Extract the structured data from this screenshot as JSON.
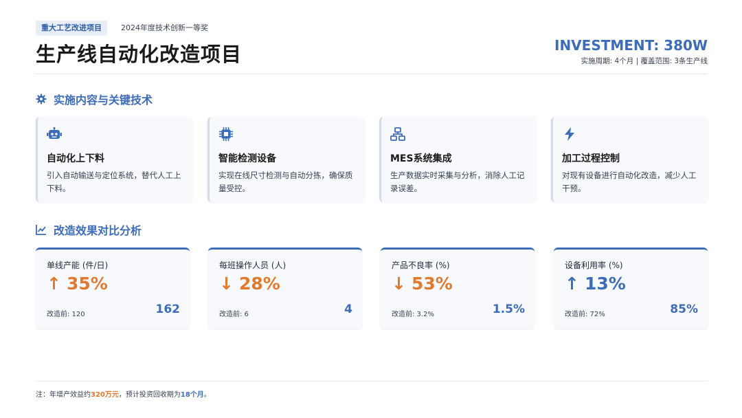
{
  "header": {
    "tag": "重大工艺改进项目",
    "award": "2024年度技术创新一等奖",
    "title": "生产线自动化改造项目",
    "investment": "INVESTMENT: 380W",
    "meta": "实施周期: 4个月 | 覆盖范围: 3条生产线"
  },
  "section_tech": {
    "title": "实施内容与关键技术",
    "icon": "gear-icon"
  },
  "tech": [
    {
      "icon": "robot-icon",
      "title": "自动化上下料",
      "desc": "引入自动输送与定位系统，替代人工上下料。"
    },
    {
      "icon": "chip-icon",
      "title": "智能检测设备",
      "desc": "实现在线尺寸检测与自动分拣，确保质量受控。"
    },
    {
      "icon": "network-icon",
      "title": "MES系统集成",
      "desc": "生产数据实时采集与分析，消除人工记录误差。"
    },
    {
      "icon": "bolt-icon",
      "title": "加工过程控制",
      "desc": "对现有设备进行自动化改造，减少人工干预。"
    }
  ],
  "section_metrics": {
    "title": "改造效果对比分析",
    "icon": "chart-line-icon"
  },
  "metrics": [
    {
      "label": "单线产能 (件/日)",
      "arrow": "↑",
      "change": "35%",
      "before": "改造前: 120",
      "after": "162",
      "color": "#e07a2f"
    },
    {
      "label": "每班操作人员 (人)",
      "arrow": "↓",
      "change": "28%",
      "before": "改造前: 6",
      "after": "4",
      "color": "#e07a2f"
    },
    {
      "label": "产品不良率 (%)",
      "arrow": "↓",
      "change": "53%",
      "before": "改造前: 3.2%",
      "after": "1.5%",
      "color": "#e07a2f"
    },
    {
      "label": "设备利用率 (%)",
      "arrow": "↑",
      "change": "13%",
      "before": "改造前: 72%",
      "after": "85%",
      "color": "#3d6cb9"
    }
  ],
  "footer": {
    "prefix": "注：年增产效益约",
    "benefit": "320万元",
    "middle": "，预计投资回收期为",
    "payback": "18个月",
    "suffix": "。"
  },
  "colors": {
    "accent_blue": "#3d6cb9",
    "accent_orange": "#e07a2f"
  }
}
